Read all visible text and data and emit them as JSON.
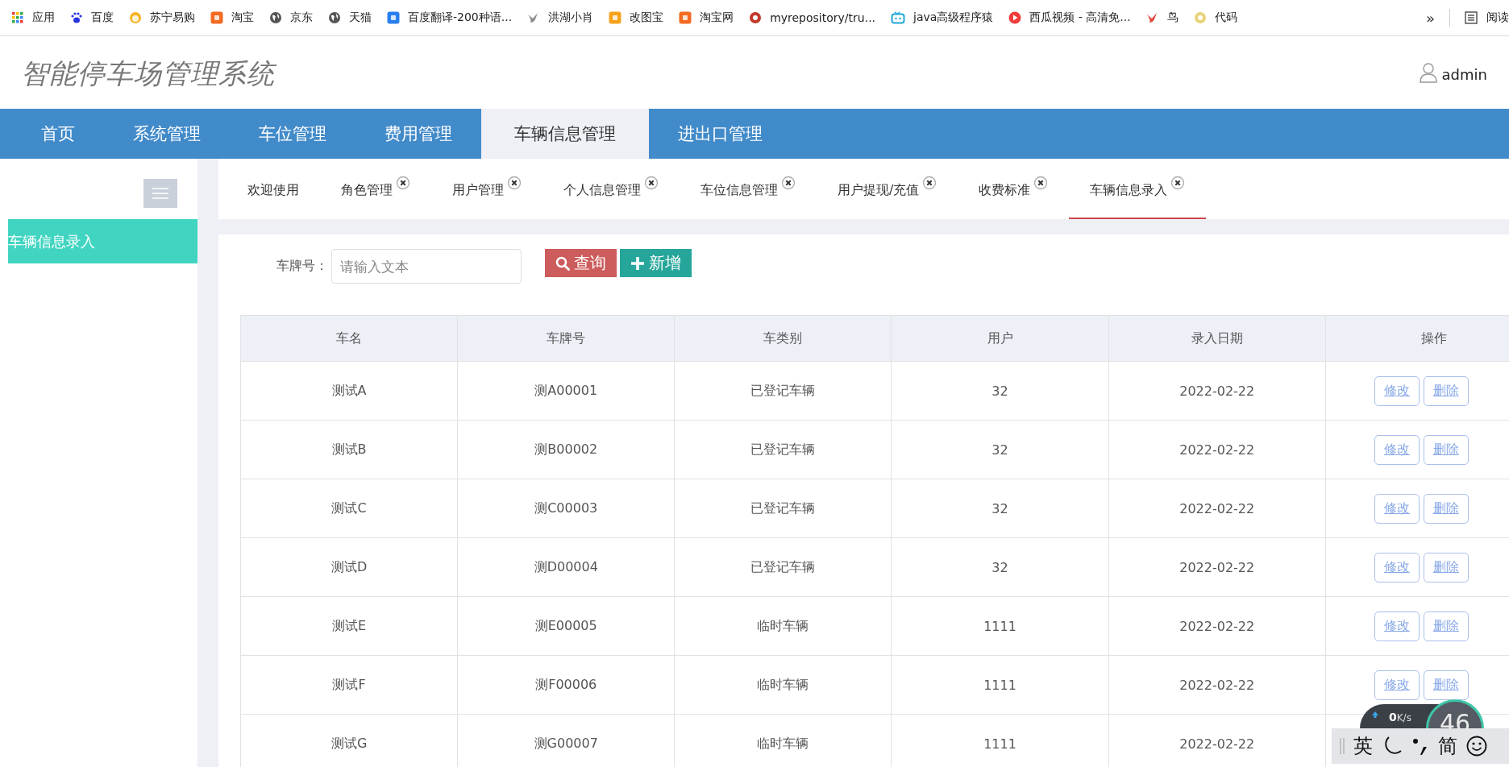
{
  "bookmarks": [
    {
      "label": "应用",
      "kind": "apps"
    },
    {
      "label": "百度",
      "kind": "paw",
      "color": "#2932e1"
    },
    {
      "label": "苏宁易购",
      "kind": "sun",
      "color": "#f5b324"
    },
    {
      "label": "淘宝",
      "kind": "tile",
      "color": "#f36a23"
    },
    {
      "label": "京东",
      "kind": "globe"
    },
    {
      "label": "天猫",
      "kind": "globe"
    },
    {
      "label": "百度翻译-200种语...",
      "kind": "tile",
      "color": "#2a7ff0"
    },
    {
      "label": "洪湖小肖",
      "kind": "bird",
      "color": "#8a8a8a"
    },
    {
      "label": "改图宝",
      "kind": "tile",
      "color": "#f7a21b"
    },
    {
      "label": "淘宝网",
      "kind": "tile",
      "color": "#f36a23"
    },
    {
      "label": "myrepository/tru...",
      "kind": "ring",
      "color": "#c0392b"
    },
    {
      "label": "java高级程序猿",
      "kind": "tv",
      "color": "#20a8d8"
    },
    {
      "label": "西瓜视频 - 高清免...",
      "kind": "play",
      "color": "#f03c3c"
    },
    {
      "label": "鸟",
      "kind": "bird",
      "color": "#e0483a"
    },
    {
      "label": "代码",
      "kind": "ring",
      "color": "#e8d27a"
    }
  ],
  "bookmarks_more": "»",
  "reading_list": "阅读",
  "header": {
    "title": "智能停车场管理系统",
    "user": "admin"
  },
  "nav": [
    {
      "label": "首页",
      "selected": false
    },
    {
      "label": "系统管理",
      "selected": false
    },
    {
      "label": "车位管理",
      "selected": false
    },
    {
      "label": "费用管理",
      "selected": false
    },
    {
      "label": "车辆信息管理",
      "selected": true
    },
    {
      "label": "进出口管理",
      "selected": false
    }
  ],
  "sidebar": {
    "items": [
      {
        "label": "车辆信息录入",
        "selected": true
      }
    ]
  },
  "tabs": [
    {
      "label": "欢迎使用",
      "closable": false,
      "selected": false
    },
    {
      "label": "角色管理",
      "closable": true,
      "selected": false
    },
    {
      "label": "用户管理",
      "closable": true,
      "selected": false
    },
    {
      "label": "个人信息管理",
      "closable": true,
      "selected": false
    },
    {
      "label": "车位信息管理",
      "closable": true,
      "selected": false
    },
    {
      "label": "用户提现/充值",
      "closable": true,
      "selected": false
    },
    {
      "label": "收费标准",
      "closable": true,
      "selected": false
    },
    {
      "label": "车辆信息录入",
      "closable": true,
      "selected": true
    }
  ],
  "search": {
    "label": "车牌号：",
    "placeholder": "请输入文本",
    "buttons": [
      {
        "label": "查询",
        "kind": "search"
      },
      {
        "label": "新增",
        "kind": "add"
      }
    ]
  },
  "table": {
    "columns": [
      "车名",
      "车牌号",
      "车类别",
      "用户",
      "录入日期",
      "操作"
    ],
    "rows": [
      {
        "cells": [
          "测试A",
          "测A00001",
          "已登记车辆",
          "32",
          "2022-02-22"
        ],
        "actions": [
          "修改",
          "删除"
        ]
      },
      {
        "cells": [
          "测试B",
          "测B00002",
          "已登记车辆",
          "32",
          "2022-02-22"
        ],
        "actions": [
          "修改",
          "删除"
        ]
      },
      {
        "cells": [
          "测试C",
          "测C00003",
          "已登记车辆",
          "32",
          "2022-02-22"
        ],
        "actions": [
          "修改",
          "删除"
        ]
      },
      {
        "cells": [
          "测试D",
          "测D00004",
          "已登记车辆",
          "32",
          "2022-02-22"
        ],
        "actions": [
          "修改",
          "删除"
        ]
      },
      {
        "cells": [
          "测试E",
          "测E00005",
          "临时车辆",
          "1111",
          "2022-02-22"
        ],
        "actions": [
          "修改",
          "删除"
        ]
      },
      {
        "cells": [
          "测试F",
          "测F00006",
          "临时车辆",
          "1111",
          "2022-02-22"
        ],
        "actions": [
          "修改",
          "删除"
        ]
      },
      {
        "cells": [
          "测试G",
          "测G00007",
          "临时车辆",
          "1111",
          "2022-02-22"
        ]
      }
    ]
  },
  "speed_widget": {
    "upload": "**0**K/s",
    "percent": "46"
  },
  "ime_bar": [
    {
      "kind": "text",
      "label": "英"
    },
    {
      "kind": "moon"
    },
    {
      "kind": "punct"
    },
    {
      "kind": "text",
      "label": "简"
    },
    {
      "kind": "smiley"
    }
  ]
}
